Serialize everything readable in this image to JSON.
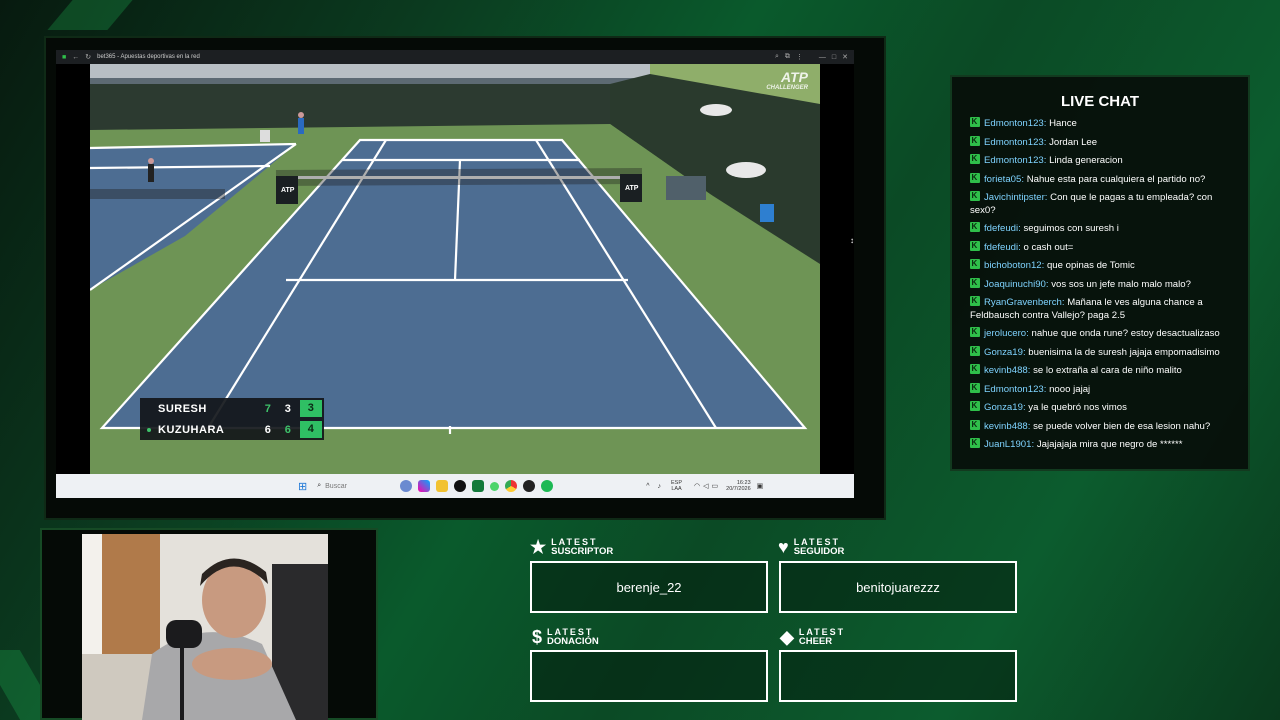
{
  "browser": {
    "tab_title": "bet365 - Apuestas deportivas en la red"
  },
  "broadcast": {
    "logo_main": "ATP",
    "logo_sub": "CHALLENGER",
    "sign_logo": "ATP"
  },
  "scoreboard": {
    "players": [
      {
        "name": "SURESH",
        "set1": "7",
        "set2": "3",
        "current": "3",
        "serving": false
      },
      {
        "name": "KUZUHARA",
        "set1": "6",
        "set2": "6",
        "current": "4",
        "serving": true
      }
    ]
  },
  "taskbar": {
    "search_placeholder": "Buscar",
    "lang_top": "ESP",
    "lang_bottom": "LAA",
    "time": "16:23",
    "date": "20/7/2026"
  },
  "chat": {
    "title": "LIVE CHAT",
    "messages": [
      {
        "user": "Edmonton123",
        "text": "Hance"
      },
      {
        "user": "Edmonton123",
        "text": "Jordan Lee"
      },
      {
        "user": "Edmonton123",
        "text": "Linda generacion"
      },
      {
        "user": "forieta05",
        "text": "Nahue esta para cualquiera el partido no?"
      },
      {
        "user": "Javichintipster",
        "text": "Con que le pagas a tu empleada? con sex0?"
      },
      {
        "user": "fdefeudi",
        "text": "seguimos con suresh i"
      },
      {
        "user": "fdefeudi",
        "text": "o cash out="
      },
      {
        "user": "bichoboton12",
        "text": "que opinas de Tomic"
      },
      {
        "user": "Joaquinuchi90",
        "text": "vos sos un jefe malo malo malo?"
      },
      {
        "user": "RyanGravenberch",
        "text": "Mañana le ves alguna chance a Feldbausch contra Vallejo? paga 2.5"
      },
      {
        "user": "jerolucero",
        "text": "nahue que onda rune? estoy desactualizaso"
      },
      {
        "user": "Gonza19",
        "text": "buenisima la de suresh jajaja empomadisimo"
      },
      {
        "user": "kevinb488",
        "text": "se lo extraña al cara de niño malito"
      },
      {
        "user": "Edmonton123",
        "text": "nooo jajaj"
      },
      {
        "user": "Gonza19",
        "text": "ya le quebró nos vimos"
      },
      {
        "user": "kevinb488",
        "text": "se puede volver bien de esa lesion nahu?"
      },
      {
        "user": "JuanL1901",
        "text": "Jajajajaja mira que negro de ******"
      }
    ]
  },
  "alerts": {
    "subscriber": {
      "label_top": "LATEST",
      "label_bottom": "SUSCRIPTOR",
      "value": "berenje_22",
      "icon": "star-icon"
    },
    "follower": {
      "label_top": "LATEST",
      "label_bottom": "SEGUIDOR",
      "value": "benitojuarezzz",
      "icon": "heart-icon"
    },
    "donation": {
      "label_top": "LATEST",
      "label_bottom": "DONACIÓN",
      "value": "",
      "icon": "dollar-icon"
    },
    "cheer": {
      "label_top": "LATEST",
      "label_bottom": "CHEER",
      "value": "",
      "icon": "diamond-icon"
    }
  },
  "colors": {
    "accent_green": "#2fbf64",
    "chat_username": "#7fd3ff",
    "court_blue": "#4d6d92",
    "court_surround": "#6e9455"
  }
}
